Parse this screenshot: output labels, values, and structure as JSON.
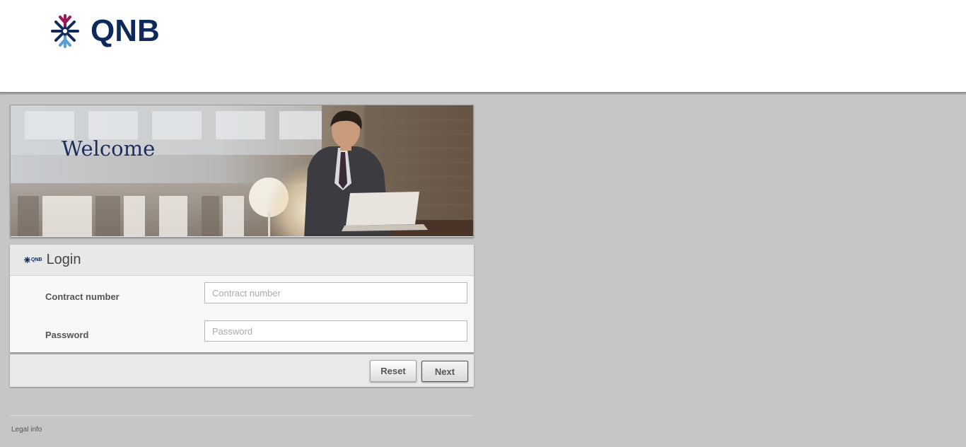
{
  "brand": {
    "name": "QNB",
    "colors": {
      "navy": "#0f2a5a",
      "magenta": "#9b1a5b",
      "background": "#c6c6c6"
    },
    "logo_icon": "qnb-logo-icon"
  },
  "banner": {
    "welcome_text": "Welcome"
  },
  "login": {
    "title": "Login",
    "mini_logo_text": "QNB",
    "contract_label": "Contract number",
    "contract_placeholder": "Contract number",
    "contract_value": "",
    "password_label": "Password",
    "password_placeholder": "Password",
    "password_value": ""
  },
  "actions": {
    "reset_label": "Reset",
    "next_label": "Next"
  },
  "footer": {
    "legal_label": "Legal info"
  }
}
